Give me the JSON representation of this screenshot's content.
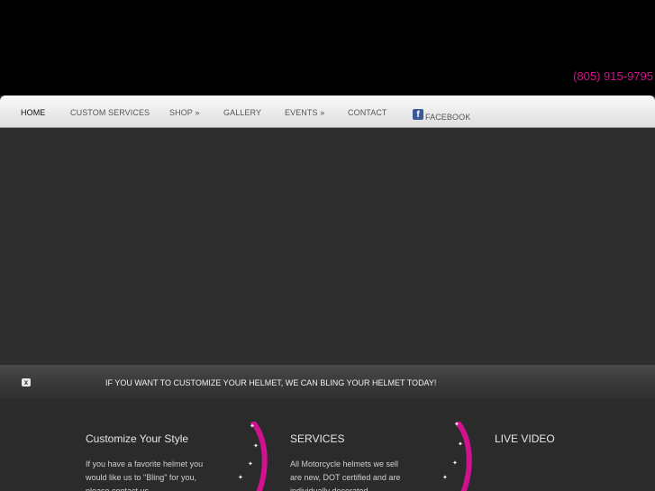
{
  "header": {
    "phone": "(805) 915-9795"
  },
  "nav": {
    "items": [
      {
        "label": "HOME"
      },
      {
        "label": "CUSTOM SERVICES"
      },
      {
        "label": "SHOP »"
      },
      {
        "label": "GALLERY"
      },
      {
        "label": "EVENTS »"
      },
      {
        "label": "CONTACT"
      },
      {
        "label": "FACEBOOK"
      }
    ],
    "active": "HOME"
  },
  "banner": {
    "text": "IF YOU WANT TO CUSTOMIZE YOUR HELMET, WE CAN BLING YOUR HELMET TODAY!",
    "close_label": "x"
  },
  "columns": [
    {
      "title": "Customize Your Style",
      "text": "If you have a favorite helmet you would like us to \"Bling\" for you, please contact us"
    },
    {
      "title": "SERVICES",
      "text": "All Motorcycle helmets we sell are new, DOT certified and are individually decorated"
    },
    {
      "title": "LIVE VIDEO",
      "text": ""
    }
  ],
  "colors": {
    "accent": "#d1118d",
    "background": "#2b2b2b",
    "header": "#000000"
  },
  "icons": {
    "facebook": "facebook-icon",
    "close": "close-icon"
  }
}
